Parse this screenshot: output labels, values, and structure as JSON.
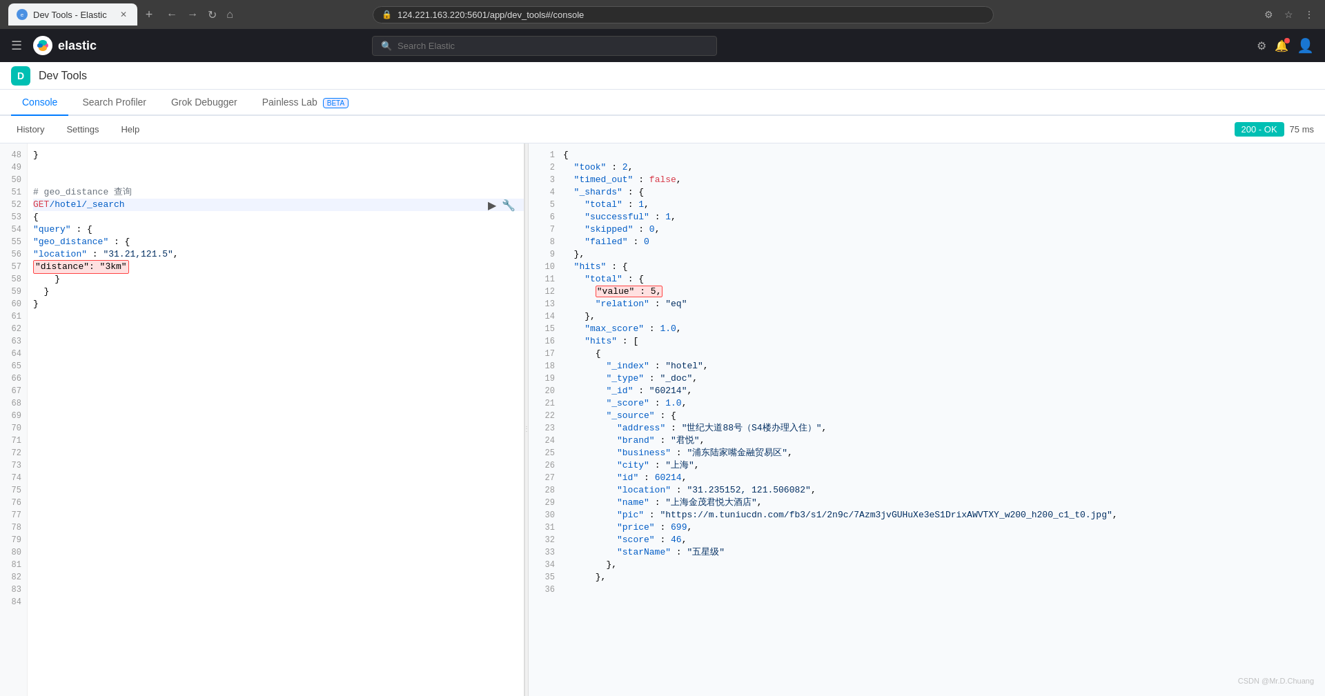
{
  "browser": {
    "tab_title": "Dev Tools - Elastic",
    "address": "124.221.163.220:5601/app/dev_tools#/console",
    "new_tab_label": "+",
    "nav_back": "←",
    "nav_forward": "→",
    "nav_refresh": "↻",
    "nav_home": "⌂"
  },
  "app": {
    "logo_text": "elastic",
    "search_placeholder": "Search Elastic",
    "dev_tools_label": "Dev Tools",
    "dev_tools_icon": "D"
  },
  "tabs": [
    {
      "id": "console",
      "label": "Console",
      "active": true
    },
    {
      "id": "search-profiler",
      "label": "Search Profiler",
      "active": false
    },
    {
      "id": "grok-debugger",
      "label": "Grok Debugger",
      "active": false
    },
    {
      "id": "painless-lab",
      "label": "Painless Lab",
      "active": false,
      "beta": true
    }
  ],
  "toolbar": {
    "history_label": "History",
    "settings_label": "Settings",
    "help_label": "Help",
    "status_label": "200 - OK",
    "time_label": "75 ms"
  },
  "editor": {
    "lines": [
      {
        "num": "48",
        "content": "}"
      },
      {
        "num": "49",
        "content": ""
      },
      {
        "num": "50",
        "content": ""
      },
      {
        "num": "51",
        "content": "# geo_distance 查询"
      },
      {
        "num": "52",
        "content": "GET /hotel/_search",
        "has_run_icons": true
      },
      {
        "num": "53",
        "content": "{"
      },
      {
        "num": "54",
        "content": "  \"query\": {"
      },
      {
        "num": "55",
        "content": "    \"geo_distance\": {"
      },
      {
        "num": "56",
        "content": "      \"location\": \"31.21,121.5\","
      },
      {
        "num": "57",
        "content": "      \"distance\": \"3km\"",
        "highlight": true
      },
      {
        "num": "58",
        "content": "    }"
      },
      {
        "num": "59",
        "content": "  }"
      },
      {
        "num": "60",
        "content": "}"
      },
      {
        "num": "61",
        "content": ""
      },
      {
        "num": "62",
        "content": ""
      },
      {
        "num": "63",
        "content": ""
      },
      {
        "num": "64",
        "content": ""
      },
      {
        "num": "65",
        "content": ""
      },
      {
        "num": "66",
        "content": ""
      },
      {
        "num": "67",
        "content": ""
      },
      {
        "num": "68",
        "content": ""
      },
      {
        "num": "69",
        "content": ""
      },
      {
        "num": "70",
        "content": ""
      },
      {
        "num": "71",
        "content": ""
      },
      {
        "num": "72",
        "content": ""
      },
      {
        "num": "73",
        "content": ""
      },
      {
        "num": "74",
        "content": ""
      },
      {
        "num": "75",
        "content": ""
      },
      {
        "num": "76",
        "content": ""
      },
      {
        "num": "77",
        "content": ""
      },
      {
        "num": "78",
        "content": ""
      },
      {
        "num": "79",
        "content": ""
      },
      {
        "num": "80",
        "content": ""
      },
      {
        "num": "81",
        "content": ""
      },
      {
        "num": "82",
        "content": ""
      },
      {
        "num": "83",
        "content": ""
      },
      {
        "num": "84",
        "content": ""
      }
    ]
  },
  "results": {
    "lines": [
      {
        "num": "1",
        "content": "{"
      },
      {
        "num": "2",
        "content": "  \"took\" : 2,"
      },
      {
        "num": "3",
        "content": "  \"timed_out\" : false,"
      },
      {
        "num": "4",
        "content": "  \"_shards\" : {"
      },
      {
        "num": "5",
        "content": "    \"total\" : 1,"
      },
      {
        "num": "6",
        "content": "    \"successful\" : 1,"
      },
      {
        "num": "7",
        "content": "    \"skipped\" : 0,"
      },
      {
        "num": "8",
        "content": "    \"failed\" : 0"
      },
      {
        "num": "9",
        "content": "  },"
      },
      {
        "num": "10",
        "content": "  \"hits\" : {"
      },
      {
        "num": "11",
        "content": "    \"total\" : {"
      },
      {
        "num": "12",
        "content": "      \"value\" : 5,",
        "highlight": true
      },
      {
        "num": "13",
        "content": "      \"relation\" : \"eq\""
      },
      {
        "num": "14",
        "content": "    },"
      },
      {
        "num": "15",
        "content": "    \"max_score\" : 1.0,"
      },
      {
        "num": "16",
        "content": "    \"hits\" : ["
      },
      {
        "num": "17",
        "content": "      {"
      },
      {
        "num": "18",
        "content": "        \"_index\" : \"hotel\","
      },
      {
        "num": "19",
        "content": "        \"_type\" : \"_doc\","
      },
      {
        "num": "20",
        "content": "        \"_id\" : \"60214\","
      },
      {
        "num": "21",
        "content": "        \"_score\" : 1.0,"
      },
      {
        "num": "22",
        "content": "        \"_source\" : {"
      },
      {
        "num": "23",
        "content": "          \"address\" : \"世纪大道88号（S4楼办理入住）\","
      },
      {
        "num": "24",
        "content": "          \"brand\" : \"君悦\","
      },
      {
        "num": "25",
        "content": "          \"business\" : \"浦东陆家嘴金融贸易区\","
      },
      {
        "num": "26",
        "content": "          \"city\" : \"上海\","
      },
      {
        "num": "27",
        "content": "          \"id\" : 60214,"
      },
      {
        "num": "28",
        "content": "          \"location\" : \"31.235152, 121.506082\","
      },
      {
        "num": "29",
        "content": "          \"name\" : \"上海金茂君悦大酒店\","
      },
      {
        "num": "30",
        "content": "          \"pic\" : \"https://m.tuniucdn.com/fb3/s1/2n9c/7Azm3jvGUHuXe3eS1DrixAWVTXY_w200_h200_c1_t0.jpg\","
      },
      {
        "num": "31",
        "content": "          \"price\" : 699,"
      },
      {
        "num": "32",
        "content": "          \"score\" : 46,"
      },
      {
        "num": "33",
        "content": "          \"starName\" : \"五星级\""
      },
      {
        "num": "34",
        "content": "        },"
      },
      {
        "num": "35",
        "content": "      },"
      },
      {
        "num": "36",
        "content": ""
      }
    ]
  },
  "watermark": "CSDN @Mr.D.Chuang"
}
